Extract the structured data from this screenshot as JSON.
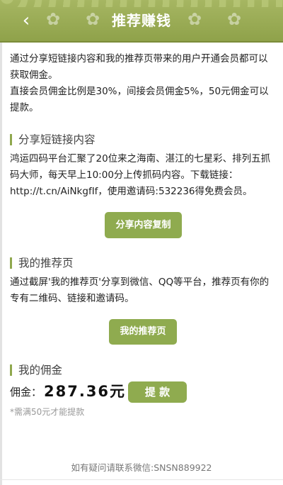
{
  "header": {
    "title": "推荐赚钱",
    "back_icon": "chevron-left-icon"
  },
  "intro": {
    "line1": "通过分享短链接内容和我的推荐页带来的用户开通会员都可以获取佣金。",
    "line2": "直接会员佣金比例是30%，间接会员佣金5%，50元佣金可以提款。"
  },
  "share_link": {
    "heading": "分享短链接内容",
    "content": "鸿运四码平台汇聚了20位来之海南、湛江的七星彩、排列五抓码大师，每天早上10:00分上传抓码内容。下载链接：http://t.cn/AiNkgfIf，使用邀请码:532236得免费会员。",
    "button": "分享内容复制"
  },
  "my_page": {
    "heading": "我的推荐页",
    "content": "通过截屏'我的推荐页'分享到微信、QQ等平台，推荐页有你的专有二维码、链接和邀请码。",
    "button": "我的推荐页"
  },
  "commission": {
    "heading": "我的佣金",
    "label": "佣金：",
    "amount": "287.36元",
    "withdraw_button": "提 款",
    "note": "*需满50元才能提款"
  },
  "footer": {
    "contact": "如有疑问请联系微信:SNSN889922"
  },
  "colors": {
    "header": "#9aad55",
    "accent": "#8fab4f",
    "button_text": "#ffffff"
  }
}
